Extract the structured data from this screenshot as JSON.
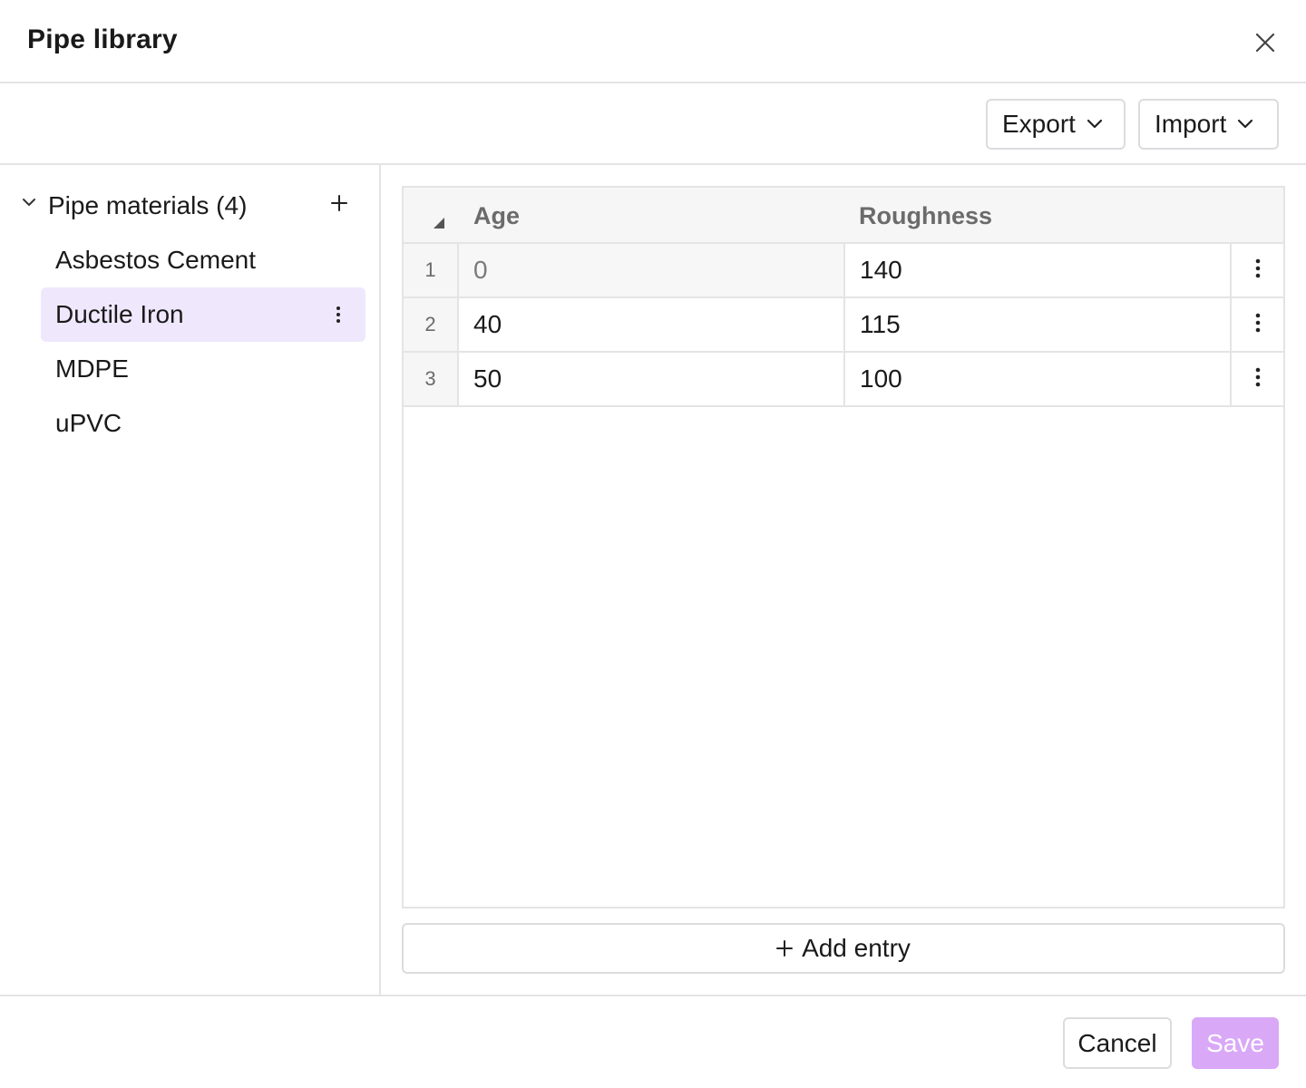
{
  "dialog": {
    "title": "Pipe library"
  },
  "toolbar": {
    "export_label": "Export",
    "import_label": "Import"
  },
  "sidebar": {
    "group_label": "Pipe materials (4)",
    "items": [
      {
        "label": "Asbestos Cement",
        "selected": false
      },
      {
        "label": "Ductile Iron",
        "selected": true
      },
      {
        "label": "MDPE",
        "selected": false
      },
      {
        "label": "uPVC",
        "selected": false
      }
    ]
  },
  "table": {
    "columns": [
      "Age",
      "Roughness"
    ],
    "rows": [
      {
        "num": "1",
        "age": "0",
        "roughness": "140",
        "age_readonly": true
      },
      {
        "num": "2",
        "age": "40",
        "roughness": "115",
        "age_readonly": false
      },
      {
        "num": "3",
        "age": "50",
        "roughness": "100",
        "age_readonly": false
      }
    ]
  },
  "add_entry_label": "Add entry",
  "footer": {
    "cancel_label": "Cancel",
    "save_label": "Save"
  },
  "icons": {
    "close": "close-icon",
    "chevron": "chevron-down-icon",
    "more": "more-vertical-icon",
    "add": "plus-icon"
  },
  "colors": {
    "selected_bg": "#efe8fd",
    "save_bg": "#d9a8f7",
    "border": "#e4e4e6"
  }
}
